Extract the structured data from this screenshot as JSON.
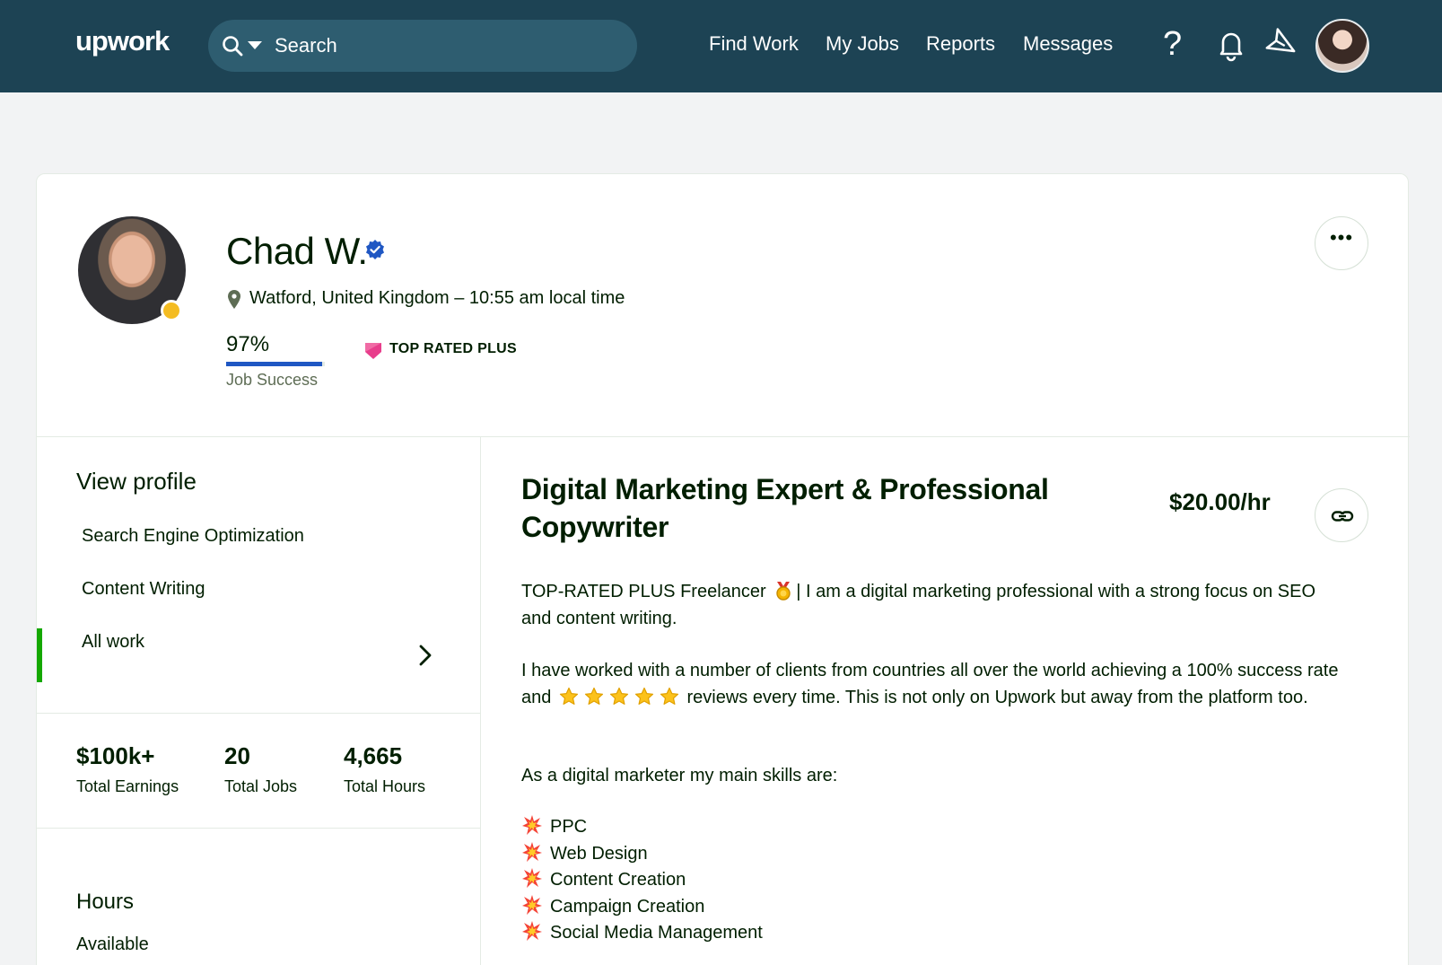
{
  "header": {
    "logo": "upwork",
    "search_placeholder": "Search",
    "nav": [
      "Find Work",
      "My Jobs",
      "Reports",
      "Messages"
    ],
    "help_label": "?",
    "icons": [
      "search-icon",
      "chevron-down-icon",
      "help-icon",
      "bell-icon",
      "send-icon",
      "user-avatar"
    ]
  },
  "profile": {
    "name": "Chad W.",
    "location": "Watford, United Kingdom – 10:55 am local time",
    "job_success": "97%",
    "job_success_fraction": 0.97,
    "job_success_label": "Job Success",
    "badge": "TOP RATED PLUS",
    "more_label": "•••"
  },
  "sidebar": {
    "view_profile": "View profile",
    "items": [
      "Search Engine Optimization",
      "Content Writing",
      "All work"
    ],
    "stats": [
      {
        "value": "$100k+",
        "label": "Total Earnings"
      },
      {
        "value": "20",
        "label": "Total Jobs"
      },
      {
        "value": "4,665",
        "label": "Total Hours"
      }
    ],
    "hours_title": "Hours",
    "hours_value": "Available"
  },
  "main": {
    "title": "Digital Marketing Expert & Professional Copywriter",
    "rate": "$20.00/hr",
    "para1_a": "TOP-RATED PLUS Freelancer",
    "para1_b": "| I am a digital marketing professional with a strong focus on SEO and content writing.",
    "para2_a": "I have worked with a number of clients from countries all over the world achieving a 100% success rate and",
    "para2_b": "reviews every time. This is not only on Upwork but away from the platform too.",
    "para3": "As a digital marketer my main skills are:",
    "skills": [
      "PPC",
      "Web Design",
      "Content Creation",
      "Campaign Creation",
      "Social Media Management"
    ]
  },
  "colors": {
    "header_bg": "#1d4354",
    "search_bg": "#2e5d70",
    "accent_green": "#14a800",
    "job_success_blue": "#1f57c3",
    "status_yellow": "#f4bc22",
    "badge_pink": "#e83e8c"
  }
}
